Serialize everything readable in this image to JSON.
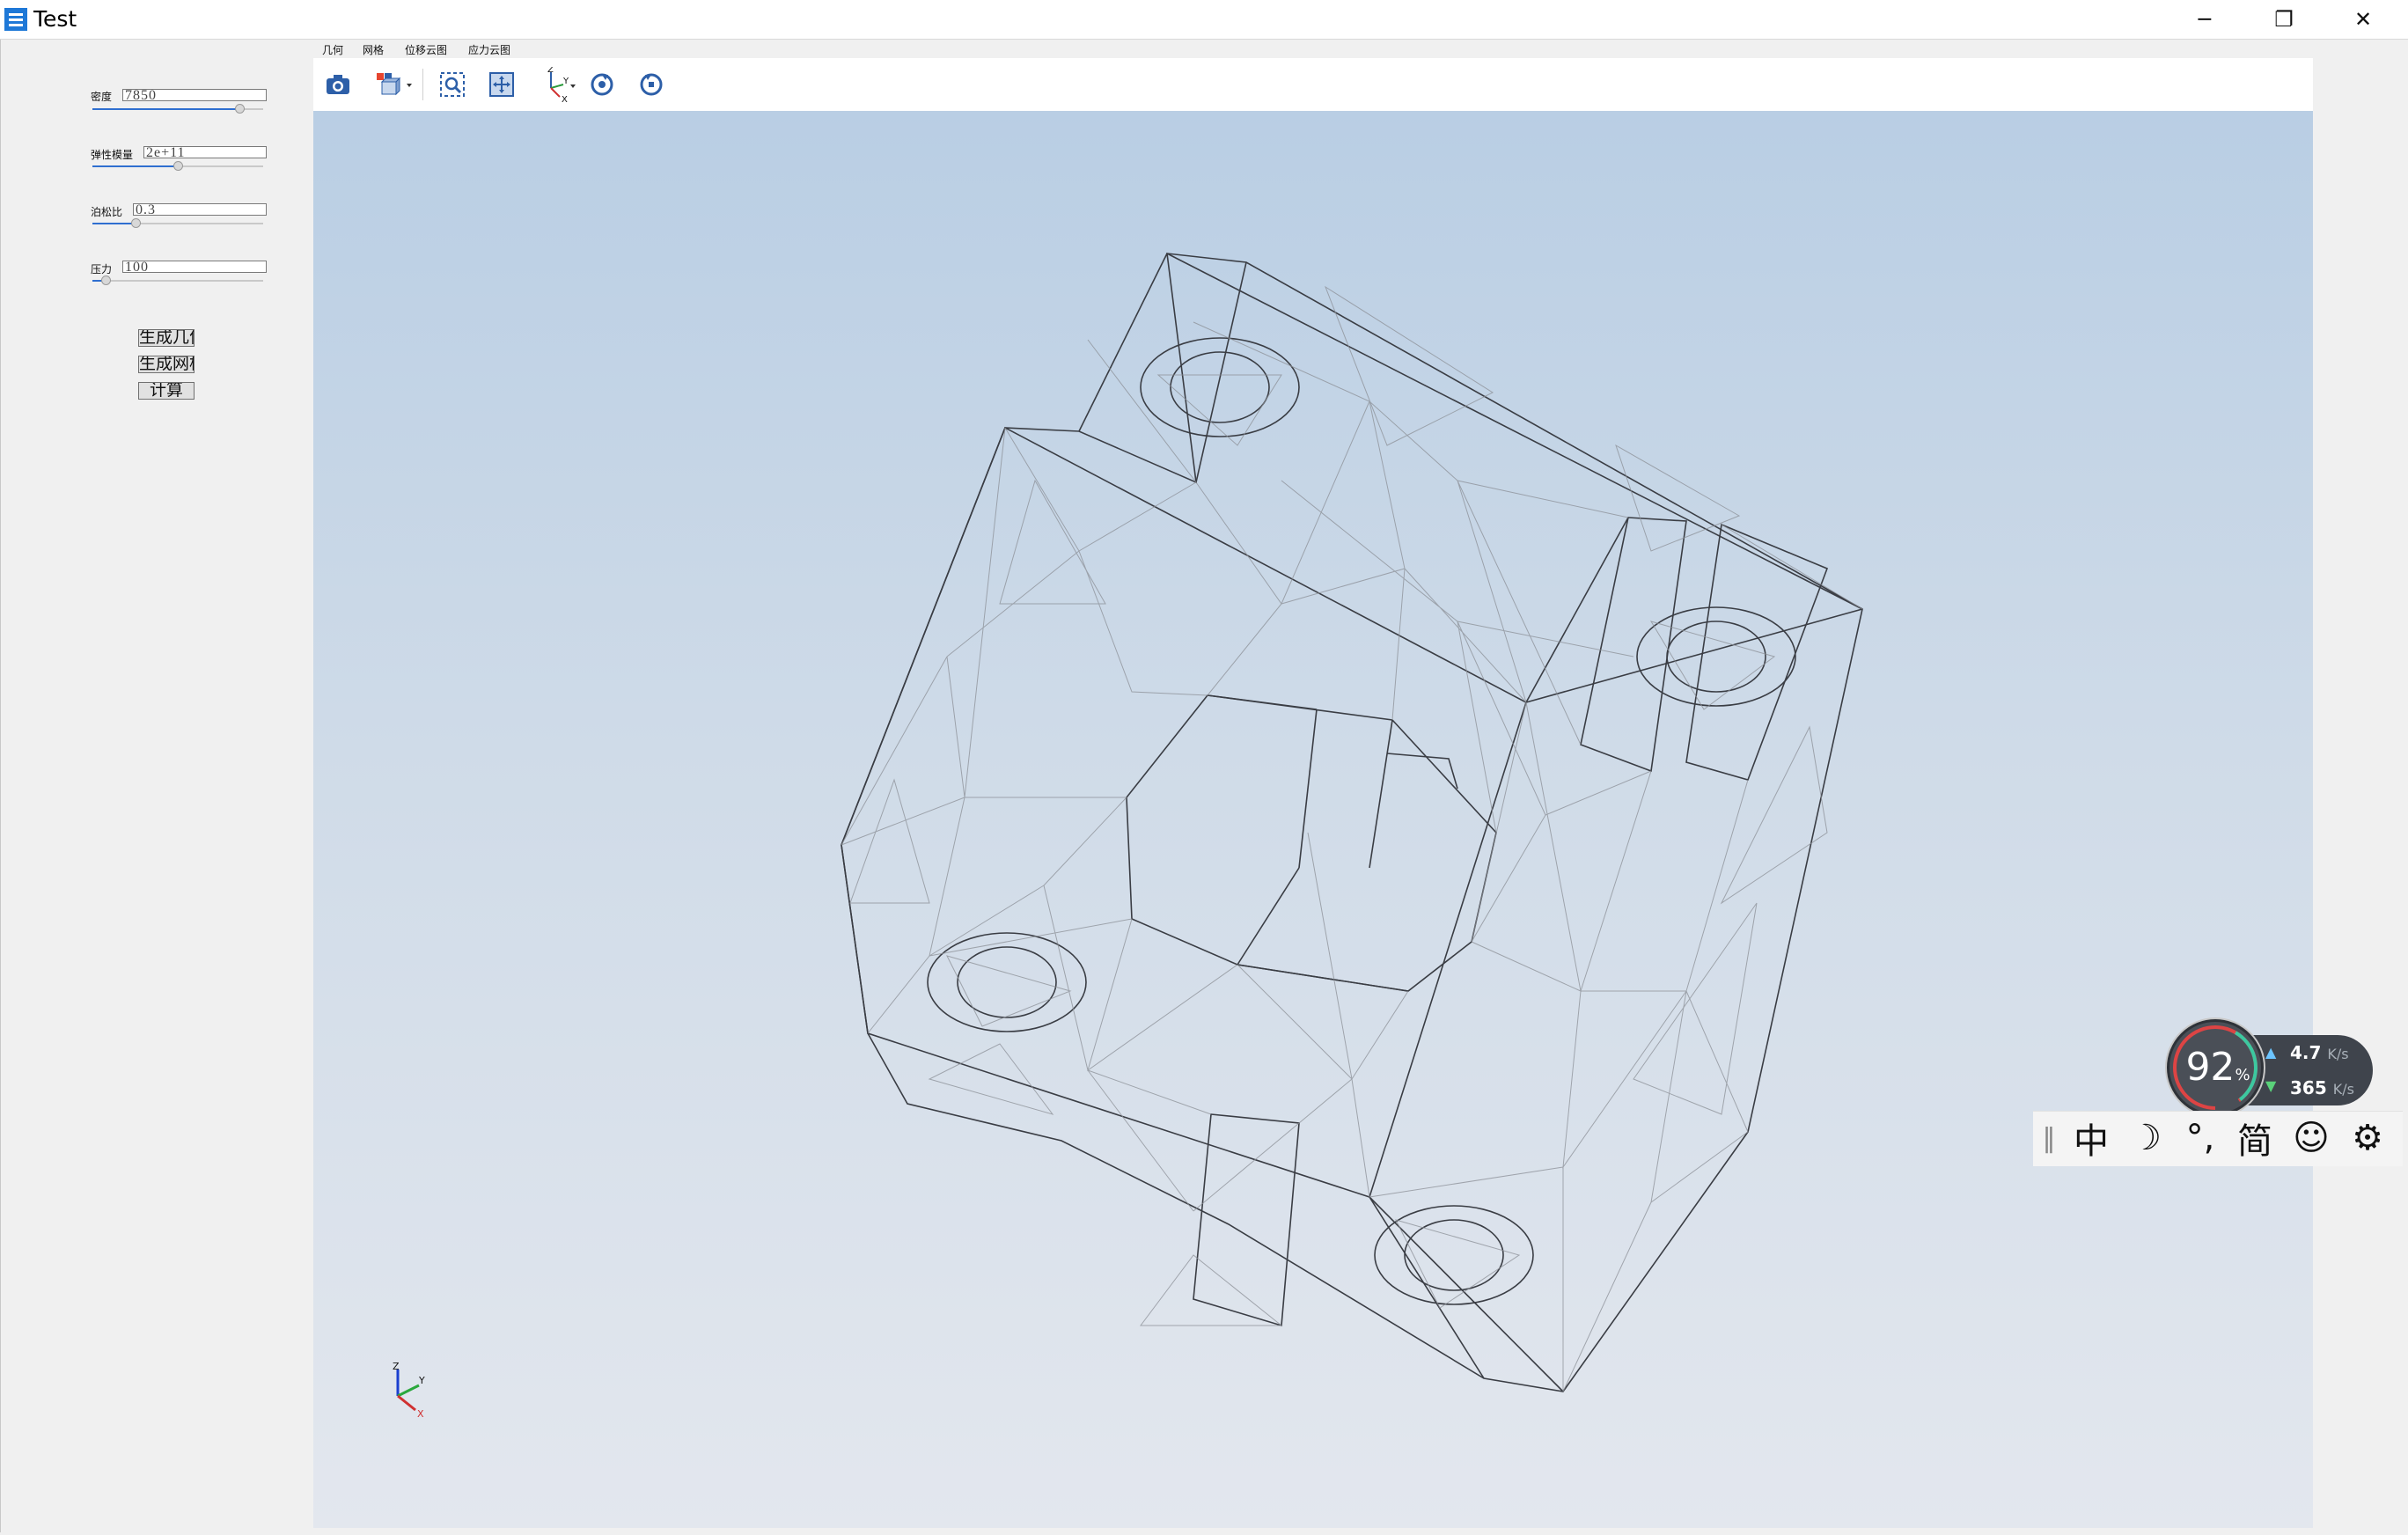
{
  "window": {
    "title": "Test",
    "controls": {
      "minimize": "─",
      "maximize": "❐",
      "close": "✕"
    }
  },
  "params": [
    {
      "label": "密度",
      "value": "7850",
      "slider": 0.88
    },
    {
      "label": "弹性模量",
      "value": "2e+11",
      "slider": 0.5
    },
    {
      "label": "泊松比",
      "value": "0.3",
      "slider": 0.25
    },
    {
      "label": "压力",
      "value": "100",
      "slider": 0.06
    }
  ],
  "actions": {
    "geometry": "生成几何",
    "mesh": "生成网格",
    "compute": "计算"
  },
  "menu": [
    "几何",
    "网格",
    "位移云图",
    "应力云图"
  ],
  "toolbar": [
    {
      "icon": "camera-icon"
    },
    {
      "icon": "view-cube-icon"
    },
    {
      "icon": "zoom-box-icon"
    },
    {
      "icon": "fit-all-icon"
    },
    {
      "icon": "axis-orientation-icon"
    },
    {
      "icon": "rotate-ccw-icon"
    },
    {
      "icon": "rotate-cw-icon"
    }
  ],
  "triad": {
    "z": "Z",
    "y": "Y",
    "x": "X"
  },
  "net": {
    "percent": "92",
    "percent_unit": "%",
    "up": "4.7",
    "down": "365",
    "unit": "K/s"
  },
  "ime": {
    "handle": "‖",
    "lang": "中",
    "moon": "☽",
    "punct": "°,",
    "script": "简",
    "emoji": "☺",
    "settings": "⚙"
  },
  "colors": {
    "viewport_top": "#b9cee4",
    "viewport_bottom": "#e3e7ee",
    "accent": "#2f6fd0"
  }
}
